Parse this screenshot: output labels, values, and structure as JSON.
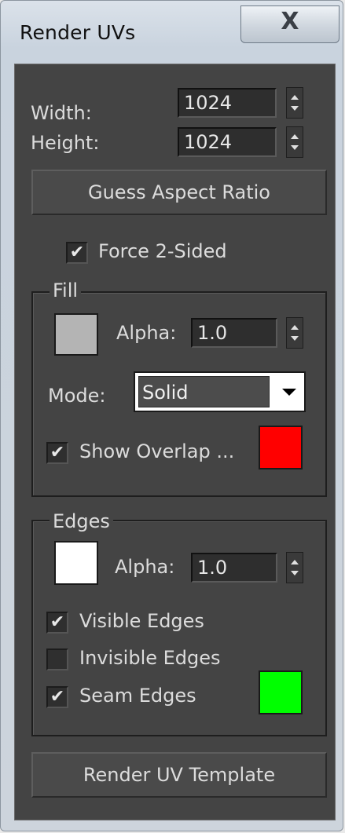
{
  "window": {
    "title": "Render UVs",
    "close_glyph": "X"
  },
  "size": {
    "width_label": "Width:",
    "width_value": "1024",
    "height_label": "Height:",
    "height_value": "1024"
  },
  "guess_aspect_label": "Guess Aspect Ratio",
  "force_2sided": {
    "label": "Force 2-Sided",
    "checked": true
  },
  "fill": {
    "group_label": "Fill",
    "swatch_color": "#b4b4b4",
    "alpha_label": "Alpha:",
    "alpha_value": "1.0",
    "mode_label": "Mode:",
    "mode_value": "Solid",
    "show_overlap": {
      "label": "Show Overlap ...",
      "checked": true,
      "color": "#ff0000"
    }
  },
  "edges": {
    "group_label": "Edges",
    "swatch_color": "#ffffff",
    "alpha_label": "Alpha:",
    "alpha_value": "1.0",
    "visible": {
      "label": "Visible Edges",
      "checked": true
    },
    "invisible": {
      "label": "Invisible Edges",
      "checked": false
    },
    "seam": {
      "label": "Seam Edges",
      "checked": true,
      "color": "#00ff00"
    }
  },
  "render_template_label": "Render UV Template",
  "icons": [
    "close-icon",
    "spinner-up-icon",
    "spinner-down-icon",
    "checkmark-icon",
    "dropdown-arrow-icon"
  ]
}
